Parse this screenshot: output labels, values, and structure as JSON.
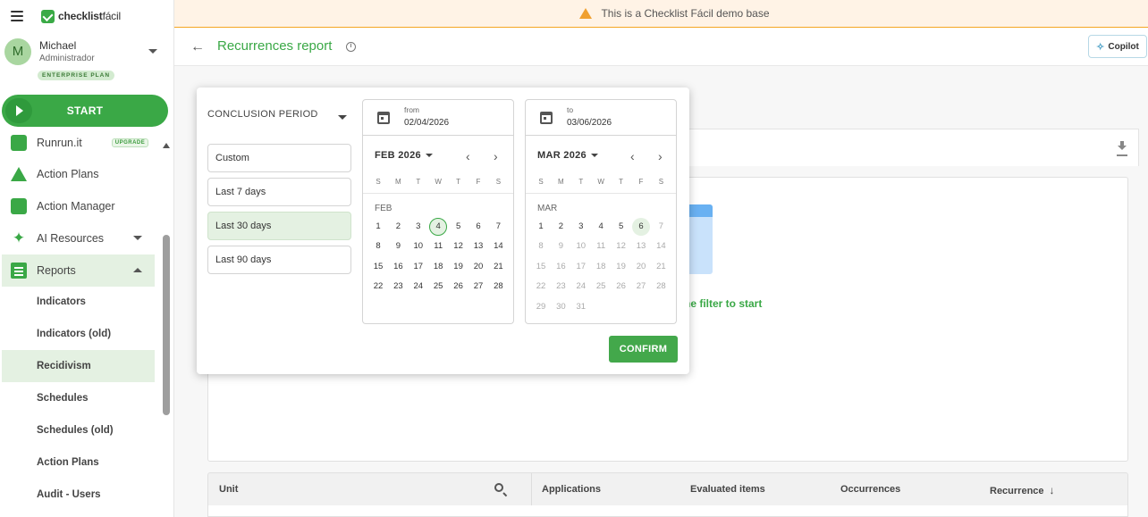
{
  "brand": {
    "name_bold": "checklist",
    "name_light": "fácil"
  },
  "user": {
    "initial": "M",
    "name": "Michael",
    "role": "Administrador",
    "plan": "ENTERPRISE PLAN"
  },
  "start_label": "START",
  "nav": {
    "items": [
      {
        "label": "Runrun.it",
        "badge": "UPGRADE",
        "icon": "runrun-icon"
      },
      {
        "label": "Action Plans",
        "icon": "warning-icon"
      },
      {
        "label": "Action Manager",
        "icon": "kanban-icon"
      },
      {
        "label": "AI Resources",
        "icon": "sparkle-icon"
      },
      {
        "label": "Reports",
        "icon": "report-icon"
      }
    ],
    "sub_items": [
      {
        "label": "Indicators"
      },
      {
        "label": "Indicators (old)"
      },
      {
        "label": "Recidivism"
      },
      {
        "label": "Schedules"
      },
      {
        "label": "Schedules (old)"
      },
      {
        "label": "Action Plans"
      },
      {
        "label": "Audit - Users"
      }
    ]
  },
  "banner": {
    "text": "This is a Checklist Fácil demo base"
  },
  "header": {
    "title": "Recurrences report",
    "copilot_label": "Copilot"
  },
  "empty_state": {
    "message": "ne filter to start"
  },
  "table": {
    "columns": [
      "Unit",
      "Applications",
      "Evaluated items",
      "Occurrences",
      "Recurrence"
    ]
  },
  "picker": {
    "period_label": "CONCLUSION PERIOD",
    "presets": [
      "Custom",
      "Last 7 days",
      "Last 30 days",
      "Last 90 days"
    ],
    "selected_preset": "Last 30 days",
    "from": {
      "label": "from",
      "value": "02/04/2026"
    },
    "to": {
      "label": "to",
      "value": "03/06/2026"
    },
    "weekdays": [
      "S",
      "M",
      "T",
      "W",
      "T",
      "F",
      "S"
    ],
    "left": {
      "title": "FEB 2026",
      "month_label": "FEB",
      "start_offset": 0,
      "days": 28,
      "selected_day": 4,
      "enabled_through": 28
    },
    "right": {
      "title": "MAR 2026",
      "month_label": "MAR",
      "start_offset": 0,
      "days": 31,
      "selected_day": 6,
      "enabled_through": 6
    },
    "confirm_label": "CONFIRM"
  }
}
